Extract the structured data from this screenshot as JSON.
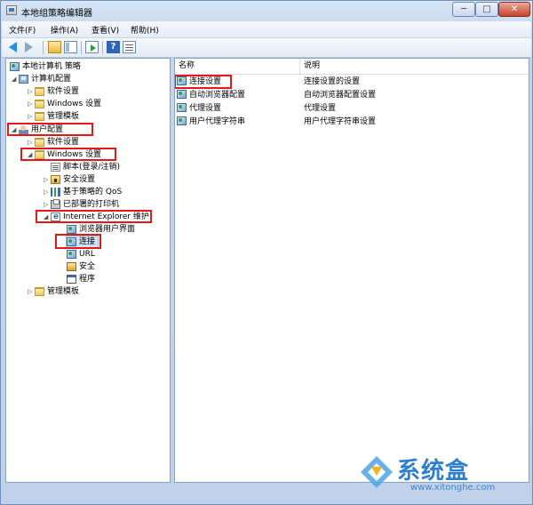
{
  "window": {
    "title": "本地组策略编辑器",
    "controls": {
      "minimize": "─",
      "maximize": "□",
      "close": "✕"
    }
  },
  "menu": [
    "文件(F)",
    "操作(A)",
    "查看(V)",
    "帮助(H)"
  ],
  "toolbar": {
    "buttons": [
      "back-arrow-icon",
      "forward-arrow-icon",
      "up-folder-icon",
      "show-tree-icon",
      "export-list-icon",
      "help-icon",
      "properties-icon"
    ],
    "help_label": "?"
  },
  "tree": {
    "root": "本地计算机 策略",
    "computer_config": "计算机配置",
    "cc_software": "软件设置",
    "cc_windows": "Windows 设置",
    "cc_admin": "管理模板",
    "user_config": "用户配置",
    "uc_software": "软件设置",
    "uc_windows": "Windows 设置",
    "scripts": "脚本(登录/注销)",
    "security": "安全设置",
    "qos": "基于策略的 QoS",
    "printers": "已部署的打印机",
    "ie_maintenance": "Internet Explorer 维护",
    "browser_ui": "浏览器用户界面",
    "connection": "连接",
    "url": "URL",
    "ie_security": "安全",
    "programs": "程序",
    "uc_admin": "管理模板"
  },
  "list": {
    "headers": {
      "name": "名称",
      "description": "说明"
    },
    "rows": [
      {
        "name": "连接设置",
        "description": "连接设置的设置"
      },
      {
        "name": "自动浏览器配置",
        "description": "自动浏览器配置设置"
      },
      {
        "name": "代理设置",
        "description": "代理设置"
      },
      {
        "name": "用户代理字符串",
        "description": "用户代理字符串设置"
      }
    ]
  },
  "watermark": {
    "text": "系统盒",
    "url": "www.xitonghe.com"
  },
  "colors": {
    "highlight": "#e01a1a",
    "accent": "#2f7fd1",
    "selection": "#cfe3f7"
  }
}
